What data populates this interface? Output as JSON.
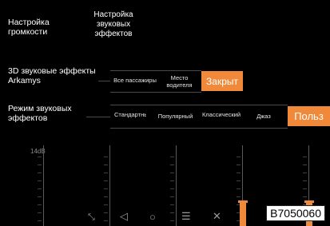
{
  "tabs": {
    "volume": "Настройка громкости",
    "effects": "Настройка звуковых эффектов"
  },
  "arkamys": {
    "label": "3D звуковые эффекты Arkamys",
    "options": [
      "Все пассажиры",
      "Место водителя"
    ],
    "active": "Закрыт"
  },
  "mode": {
    "label": "Режим звуковых эффектов",
    "options": [
      "Стандартный",
      "Популярный",
      "Классический",
      "Джаз"
    ],
    "active": "Польз"
  },
  "equalizer": {
    "scale_top": "14dB"
  },
  "navbar": {
    "icons": [
      "collapse-icon",
      "back-icon",
      "home-icon",
      "menu-icon",
      "close-icon"
    ]
  },
  "badge": "B7050060",
  "colors": {
    "accent": "#f08a3a",
    "background": "#000000"
  }
}
